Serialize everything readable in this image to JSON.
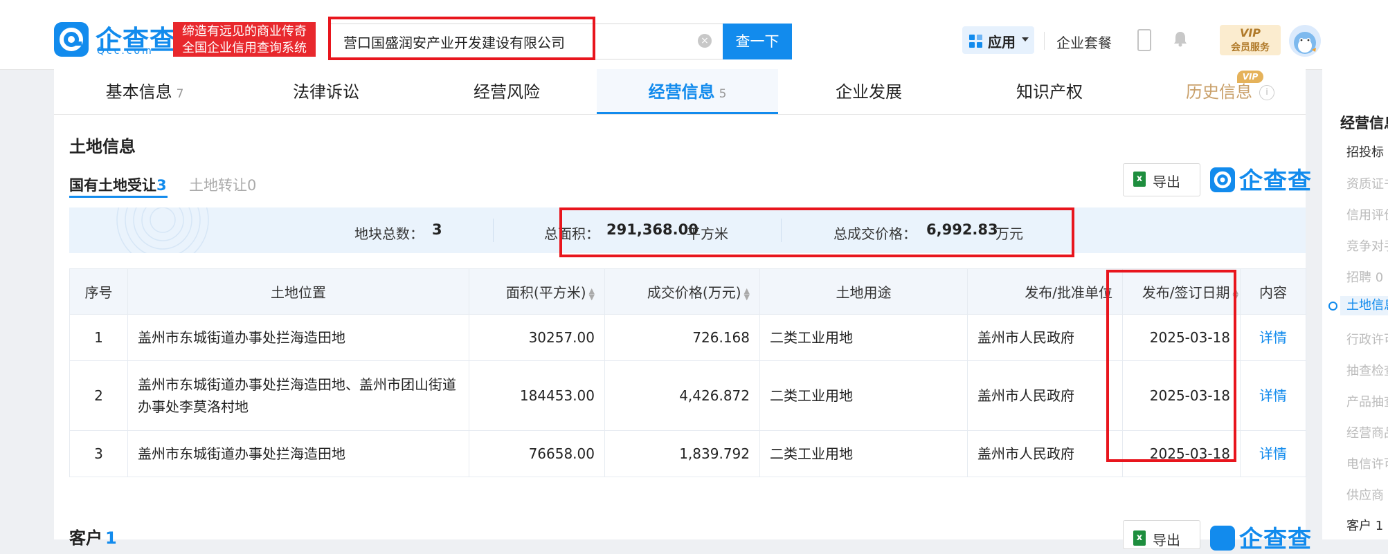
{
  "header": {
    "logo_text": "企查查",
    "logo_sub": "Qcc.com",
    "slogan_line1": "缔造有远见的商业传奇",
    "slogan_line2": "全国企业信用查询系统",
    "search_value": "营口国盛润安产业开发建设有限公司",
    "search_button": "查一下",
    "app_label": "应用",
    "package_label": "企业套餐",
    "vip_top": "VIP",
    "vip_bottom": "会员服务"
  },
  "nav": {
    "tabs": [
      {
        "label": "基本信息",
        "count": "7"
      },
      {
        "label": "法律诉讼",
        "count": ""
      },
      {
        "label": "经营风险",
        "count": ""
      },
      {
        "label": "经营信息",
        "count": "5"
      },
      {
        "label": "企业发展",
        "count": ""
      },
      {
        "label": "知识产权",
        "count": ""
      },
      {
        "label": "历史信息",
        "count": ""
      }
    ],
    "active_index": 3,
    "vip_tag": "VIP",
    "info_glyph": "i"
  },
  "section": {
    "title": "土地信息",
    "subtab_active_label": "国有土地受让",
    "subtab_active_count": "3",
    "subtab_inactive_label": "土地转让",
    "subtab_inactive_count": "0",
    "export_label": "导出",
    "brand_text": "企查查"
  },
  "summary": {
    "parcels_label": "地块总数：",
    "parcels_value": "3",
    "area_label": "总面积：",
    "area_value": "291,368.00",
    "area_unit": "平方米",
    "price_label": "总成交价格：",
    "price_value": "6,992.83",
    "price_unit": "万元"
  },
  "table": {
    "headers": [
      "序号",
      "土地位置",
      "面积(平方米)",
      "成交价格(万元)",
      "土地用途",
      "发布/批准单位",
      "发布/签订日期",
      "内容"
    ],
    "rows": [
      {
        "no": "1",
        "location": "盖州市东城街道办事处拦海造田地",
        "area": "30257.00",
        "price": "726.168",
        "use": "二类工业用地",
        "unit": "盖州市人民政府",
        "date": "2025-03-18",
        "link": "详情"
      },
      {
        "no": "2",
        "location": "盖州市东城街道办事处拦海造田地、盖州市团山街道办事处李莫洛村地",
        "area": "184453.00",
        "price": "4,426.872",
        "use": "二类工业用地",
        "unit": "盖州市人民政府",
        "date": "2025-03-18",
        "link": "详情"
      },
      {
        "no": "3",
        "location": "盖州市东城街道办事处拦海造田地",
        "area": "76658.00",
        "price": "1,839.792",
        "use": "二类工业用地",
        "unit": "盖州市人民政府",
        "date": "2025-03-18",
        "link": "详情"
      }
    ]
  },
  "customer": {
    "title": "客户",
    "count": "1",
    "export_label": "导出",
    "brand_text": "企查查"
  },
  "sidebar": {
    "heading": "经营信息",
    "items": [
      "招投标",
      "资质证书",
      "信用评价",
      "竞争对手",
      "招聘 0",
      "土地信息",
      "行政许可",
      "抽查检查",
      "产品抽查",
      "经营商品",
      "电信许可",
      "供应商",
      "客户 1"
    ],
    "active_index": 5
  },
  "colors": {
    "brand_blue": "#128bed",
    "annotation_red": "#e8151d",
    "slogan_red": "#e8282d",
    "vip_gold": "#c9a06a"
  }
}
